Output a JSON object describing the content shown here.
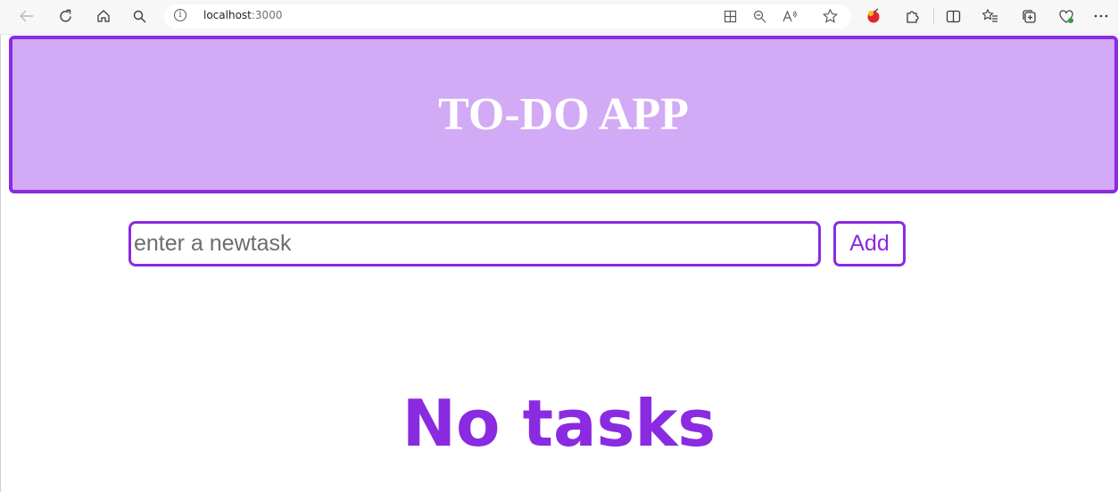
{
  "browser": {
    "address": {
      "host": "localhost",
      "port": ":3000"
    },
    "icons": {
      "back": "back-arrow-icon",
      "refresh": "refresh-icon",
      "home": "home-icon",
      "search": "search-icon",
      "site_info": "info-icon",
      "app_available": "app-available-icon",
      "zoom": "zoom-out-icon",
      "read_aloud": "read-aloud-icon",
      "favorite": "star-icon",
      "profile": "extension-icon",
      "extensions": "puzzle-icon",
      "split": "split-screen-icon",
      "favorites": "favorites-icon",
      "collections": "collections-icon",
      "performance": "performance-icon",
      "more": "more-icon"
    }
  },
  "app": {
    "title": "TO-DO APP",
    "input": {
      "placeholder": "enter a newtask",
      "value": ""
    },
    "add_label": "Add",
    "empty_message": "No tasks"
  },
  "colors": {
    "accent": "#8a2be2",
    "header_bg": "#d2aaf5",
    "title_text": "#ffffff"
  }
}
